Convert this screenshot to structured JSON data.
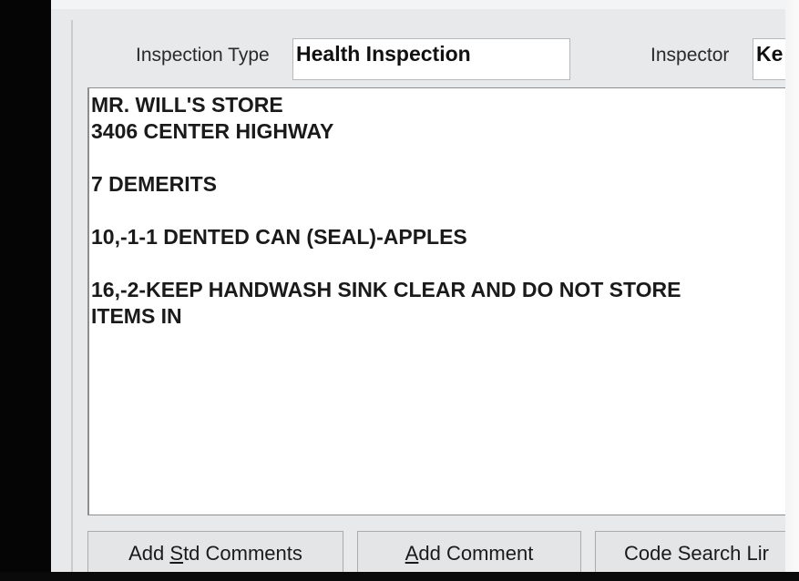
{
  "header": {
    "inspection_type_label": "Inspection Type",
    "inspection_type_value": "Health Inspection",
    "inspector_label": "Inspector",
    "inspector_value": "Ke"
  },
  "comments": {
    "lines": [
      "MR. WILL'S STORE",
      "3406 CENTER HIGHWAY",
      "",
      "7 DEMERITS",
      "",
      "10,-1-1 DENTED CAN (SEAL)-APPLES",
      "",
      "16,-2-KEEP HANDWASH SINK CLEAR AND DO NOT STORE",
      "ITEMS IN"
    ]
  },
  "buttons": {
    "add_std_comments": {
      "pre": "Add ",
      "mnemonic": "S",
      "post": "td Comments"
    },
    "add_comment": {
      "pre": "",
      "mnemonic": "A",
      "post": "dd Comment"
    },
    "code_search": {
      "label": "Code Search Lir"
    }
  }
}
